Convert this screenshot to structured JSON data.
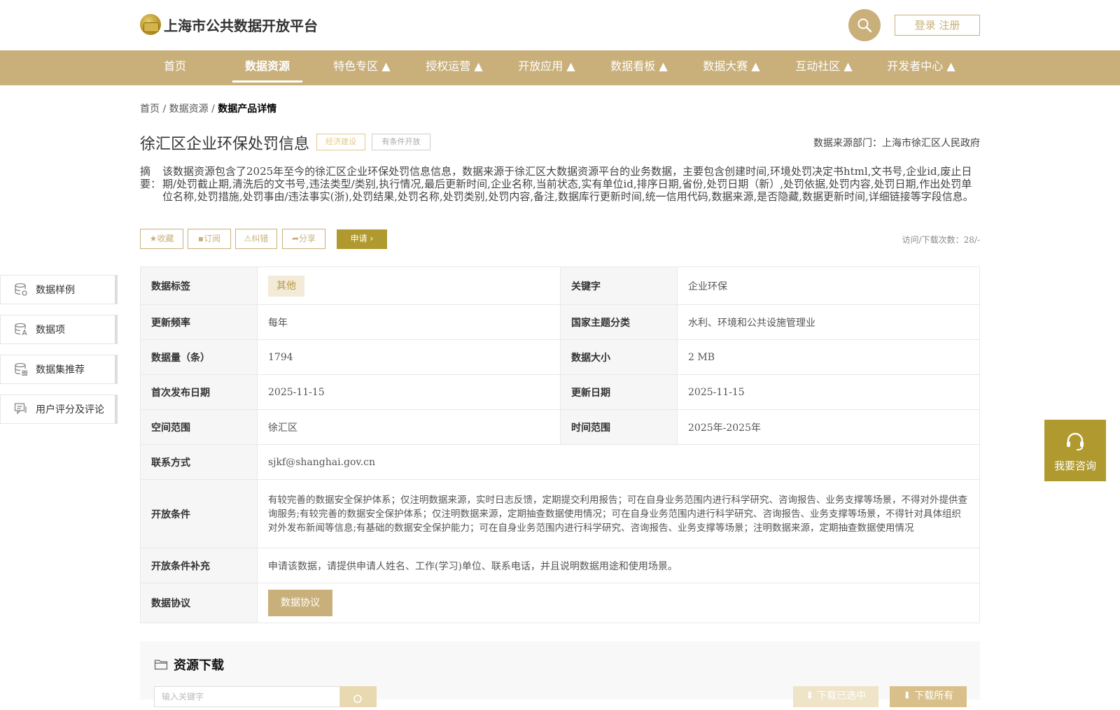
{
  "header": {
    "site_title": "上海市公共数据开放平台",
    "login_label": "登录 注册"
  },
  "nav": [
    {
      "label": "首页"
    },
    {
      "label": "数据资源"
    },
    {
      "label": "特色专区 ▲"
    },
    {
      "label": "授权运营 ▲"
    },
    {
      "label": "开放应用 ▲"
    },
    {
      "label": "数据看板 ▲"
    },
    {
      "label": "数据大赛 ▲"
    },
    {
      "label": "互动社区 ▲"
    },
    {
      "label": "开发者中心 ▲"
    }
  ],
  "breadcrumb": {
    "home": "首页",
    "sep": "/",
    "section": "数据资源",
    "current": "数据产品详情"
  },
  "dataset": {
    "title": "徐汇区企业环保处罚信息",
    "tag_category": "经济建设",
    "tag_access": "有条件开放",
    "source": "数据来源部门：上海市徐汇区人民政府",
    "abstract_label": "摘要：",
    "abstract": "该数据资源包含了2025年至今的徐汇区企业环保处罚信息信息，数据来源于徐汇区大数据资源平台的业务数据，主要包含创建时间,环境处罚决定书html,文书号,企业id,废止日期/处罚截止期,清洗后的文书号,违法类型/类别,执行情况,最后更新时间,企业名称,当前状态,实有单位id,排序日期,省份,处罚日期（新）,处罚依据,处罚内容,处罚日期,作出处罚单位名称,处罚措施,处罚事由/违法事实(浙),处罚结果,处罚名称,处罚类别,处罚内容,备注,数据库行更新时间,统一信用代码,数据来源,是否隐藏,数据更新时间,详细链接等字段信息。"
  },
  "actions": {
    "favorite": "收藏",
    "subscribe": "订阅",
    "report": "纠错",
    "share": "分享",
    "apply": "申请",
    "visits": "访问/下载次数：28/-"
  },
  "sidebar": [
    {
      "label": "数据样例",
      "icon": "database-icon"
    },
    {
      "label": "数据项",
      "icon": "database-field-icon"
    },
    {
      "label": "数据集推荐",
      "icon": "database-grid-icon"
    },
    {
      "label": "用户评分及评论",
      "icon": "comment-icon"
    }
  ],
  "info": {
    "tag_key": "数据标签",
    "tag_value": "其他",
    "keyword_key": "关键字",
    "keyword_value": "企业环保",
    "freq_key": "更新频率",
    "freq_value": "每年",
    "theme_key": "国家主题分类",
    "theme_value": "水利、环境和公共设施管理业",
    "count_key": "数据量（条）",
    "count_value": "1794",
    "size_key": "数据大小",
    "size_value": "2 MB",
    "first_key": "首次发布日期",
    "first_value": "2025-11-15",
    "update_key": "更新日期",
    "update_value": "2025-11-15",
    "space_key": "空间范围",
    "space_value": "徐汇区",
    "time_key": "时间范围",
    "time_value": "2025年-2025年",
    "contact_key": "联系方式",
    "contact_value": "sjkf@shanghai.gov.cn",
    "cond_key": "开放条件",
    "cond_value": "有较完善的数据安全保护体系；仅注明数据来源，实时日志反馈，定期提交利用报告；可在自身业务范围内进行科学研究、咨询报告、业务支撑等场景，不得对外提供查询服务;有较完善的数据安全保护体系；仅注明数据来源，定期抽查数据使用情况；可在自身业务范围内进行科学研究、咨询报告、业务支撑等场景，不得针对具体组织对外发布新闻等信息;有基础的数据安全保护能力；可在自身业务范围内进行科学研究、咨询报告、业务支撑等场景；注明数据来源，定期抽查数据使用情况",
    "supp_key": "开放条件补充",
    "supp_value": "申请该数据，请提供申请人姓名、工作(学习)单位、联系电话，并且说明数据用途和使用场景。",
    "proto_key": "数据协议",
    "proto_button": "数据协议"
  },
  "download": {
    "title": "资源下载",
    "search_placeholder": "输入关键字",
    "download_selected": "下载已选中",
    "download_all": "下载所有"
  },
  "consult": {
    "label": "我要咨询"
  },
  "colors": {
    "brand": "#c9b07b",
    "accent": "#b09a2f"
  }
}
